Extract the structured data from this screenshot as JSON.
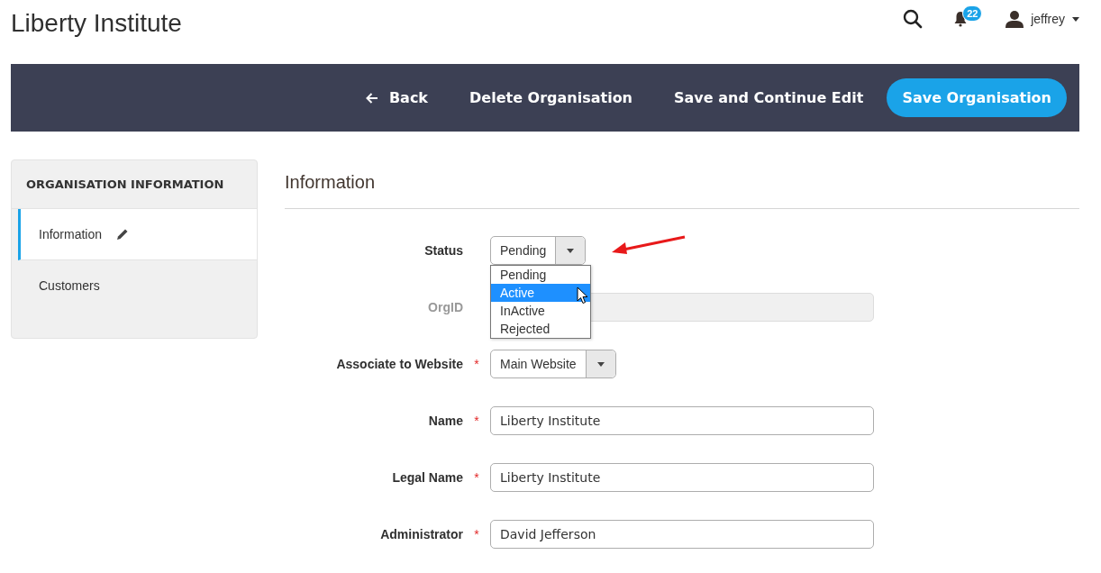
{
  "header": {
    "title": "Liberty Institute",
    "notifications": "22",
    "user": "jeffrey"
  },
  "toolbar": {
    "buttons": [
      {
        "label": "Back",
        "kind": "back"
      },
      {
        "label": "Delete Organisation",
        "kind": "plain"
      },
      {
        "label": "Save and Continue Edit",
        "kind": "plain"
      },
      {
        "label": "Save Organisation",
        "kind": "primary"
      }
    ]
  },
  "sidebar": {
    "title": "ORGANISATION INFORMATION",
    "items": [
      {
        "label": "Information",
        "selected": true
      },
      {
        "label": "Customers",
        "selected": false
      }
    ]
  },
  "section": {
    "title": "Information",
    "fields": [
      {
        "label": "Status",
        "kind": "select",
        "disabled": false,
        "value": "Pending",
        "dropdown": {
          "options": [
            {
              "label": "Pending",
              "selected": false
            },
            {
              "label": "Active",
              "selected": true
            },
            {
              "label": "InActive",
              "selected": false
            },
            {
              "label": "Rejected",
              "selected": false
            }
          ]
        }
      },
      {
        "label": "OrgID",
        "kind": "text",
        "disabled": true
      },
      {
        "label": "Associate to Website",
        "kind": "select",
        "required_mark": "*",
        "disabled": false,
        "value": "Main Website"
      },
      {
        "label": "Name",
        "kind": "text",
        "required_mark": "*",
        "disabled": false,
        "value": "Liberty Institute"
      },
      {
        "label": "Legal Name",
        "kind": "text",
        "required_mark": "*",
        "disabled": false,
        "value": "Liberty Institute"
      },
      {
        "label": "Administrator",
        "kind": "text",
        "required_mark": "*",
        "disabled": false,
        "value": "David Jefferson"
      }
    ]
  }
}
